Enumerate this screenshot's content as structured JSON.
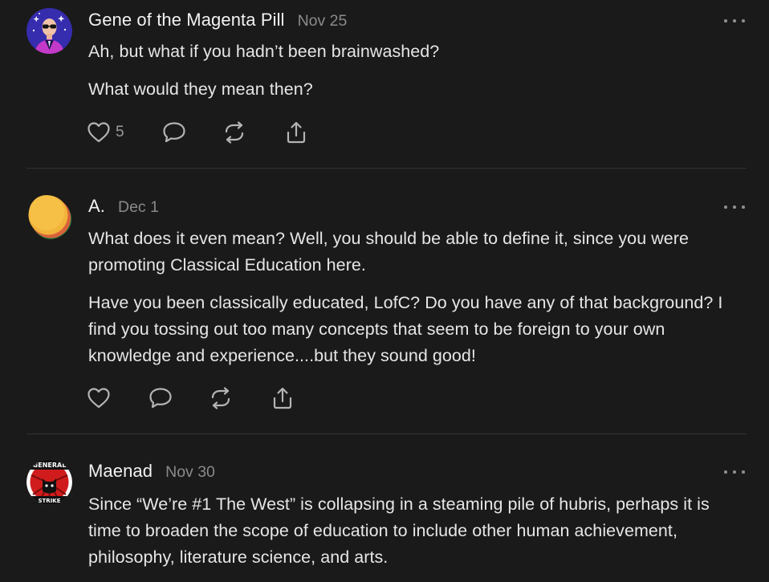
{
  "comments": [
    {
      "author": "Gene of the Magenta Pill",
      "date": "Nov 25",
      "paragraphs": [
        "Ah, but what if you hadn’t been brainwashed?",
        "What would they mean then?"
      ],
      "like_count": "5"
    },
    {
      "author": "A.",
      "date": "Dec 1",
      "paragraphs": [
        "What does it even mean? Well, you should be able to define it, since you were promoting Classical Education here.",
        "Have you been classically educated, LofC? Do you have any of that background? I find you tossing out too many concepts that seem to be foreign to your own knowledge and experience....but they sound good!"
      ]
    },
    {
      "author": "Maenad",
      "date": "Nov 30",
      "paragraphs": [
        "Since “We’re #1 The West” is collapsing in a steaming pile of hubris, perhaps it is time to broaden the scope of education to include other human achievement, philosophy, literature science, and arts."
      ],
      "avatar_text": {
        "top": "GENERAL",
        "bottom": "STRIKE"
      }
    }
  ],
  "icons": {
    "like": "heart-icon",
    "reply": "speech-bubble-icon",
    "restack": "restack-icon",
    "share": "share-icon",
    "more": "more-dots-icon"
  },
  "colors": {
    "background": "#1a1a1a",
    "text": "#e6e6e6",
    "muted": "#8a8a8a",
    "icon": "#b4b4b4",
    "divider": "#333333",
    "gene_avatar_bg": "#3b2aa8",
    "gene_avatar_accent": "#d43ad4"
  }
}
